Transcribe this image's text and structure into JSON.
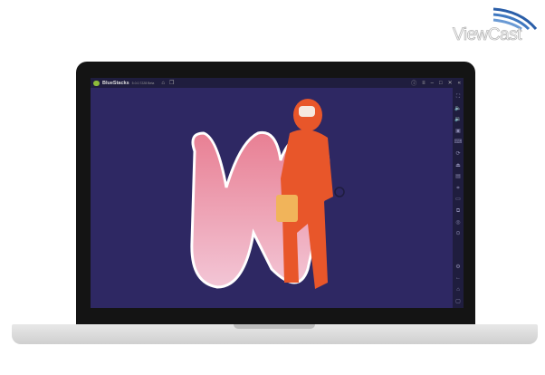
{
  "watermark": {
    "brand": "ViewCast"
  },
  "window": {
    "app_name": "BlueStacks",
    "version": "5.0.0.7228 Beta"
  },
  "titlebar_icons": [
    "home-icon",
    "multi-instance-icon"
  ],
  "window_controls": [
    "help-icon",
    "menu-icon",
    "minimize-icon",
    "maximize-icon",
    "close-icon",
    "collapse-sidebar-icon"
  ],
  "sidebar": {
    "icons": [
      "fullscreen-icon",
      "volume-up-icon",
      "volume-down-icon",
      "media-icon",
      "keyboard-icon",
      "rotate-icon",
      "install-apk-icon",
      "screenshot-icon",
      "macro-icon",
      "folder-icon",
      "multi-instance-icon",
      "eco-mode-icon",
      "sync-icon",
      "settings-icon",
      "back-icon",
      "home-icon",
      "recent-apps-icon"
    ]
  },
  "colors": {
    "screen_bg": "#2e2863",
    "titlebar": "#1f1d3e",
    "astronaut": "#e8562a"
  }
}
